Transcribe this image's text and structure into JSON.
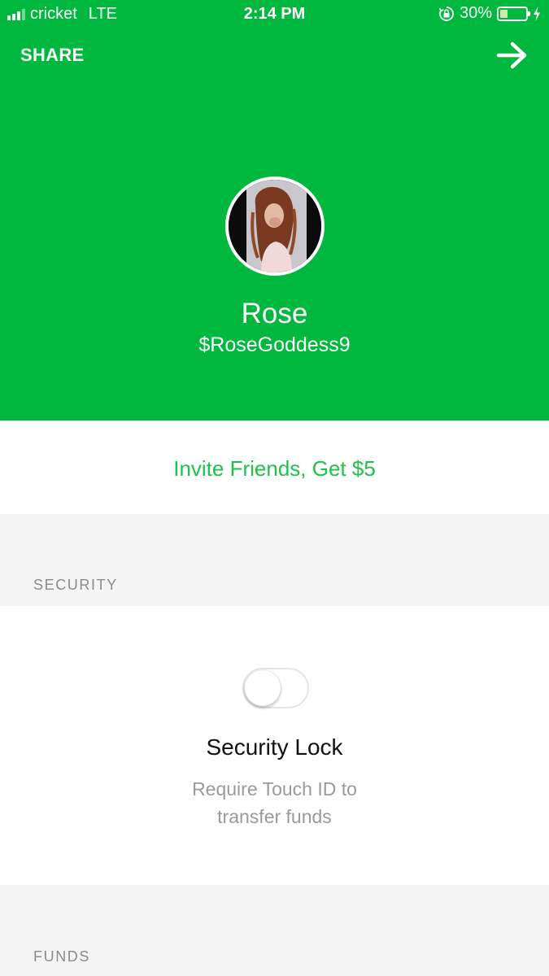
{
  "status_bar": {
    "carrier": "cricket",
    "network": "LTE",
    "time": "2:14 PM",
    "battery_percent": "30%",
    "battery_level": 0.3
  },
  "header": {
    "share_label": "SHARE",
    "forward_icon": "arrow-right-icon",
    "background_color": "#00b83d"
  },
  "profile": {
    "name": "Rose",
    "cashtag": "$RoseGoddess9"
  },
  "invite": {
    "label": "Invite Friends, Get $5",
    "color": "#1ec24a"
  },
  "sections": {
    "security_header": "SECURITY",
    "funds_header": "FUNDS"
  },
  "security_lock": {
    "toggle_on": false,
    "title": "Security Lock",
    "description_line1": "Require Touch ID to",
    "description_line2": "transfer funds"
  }
}
